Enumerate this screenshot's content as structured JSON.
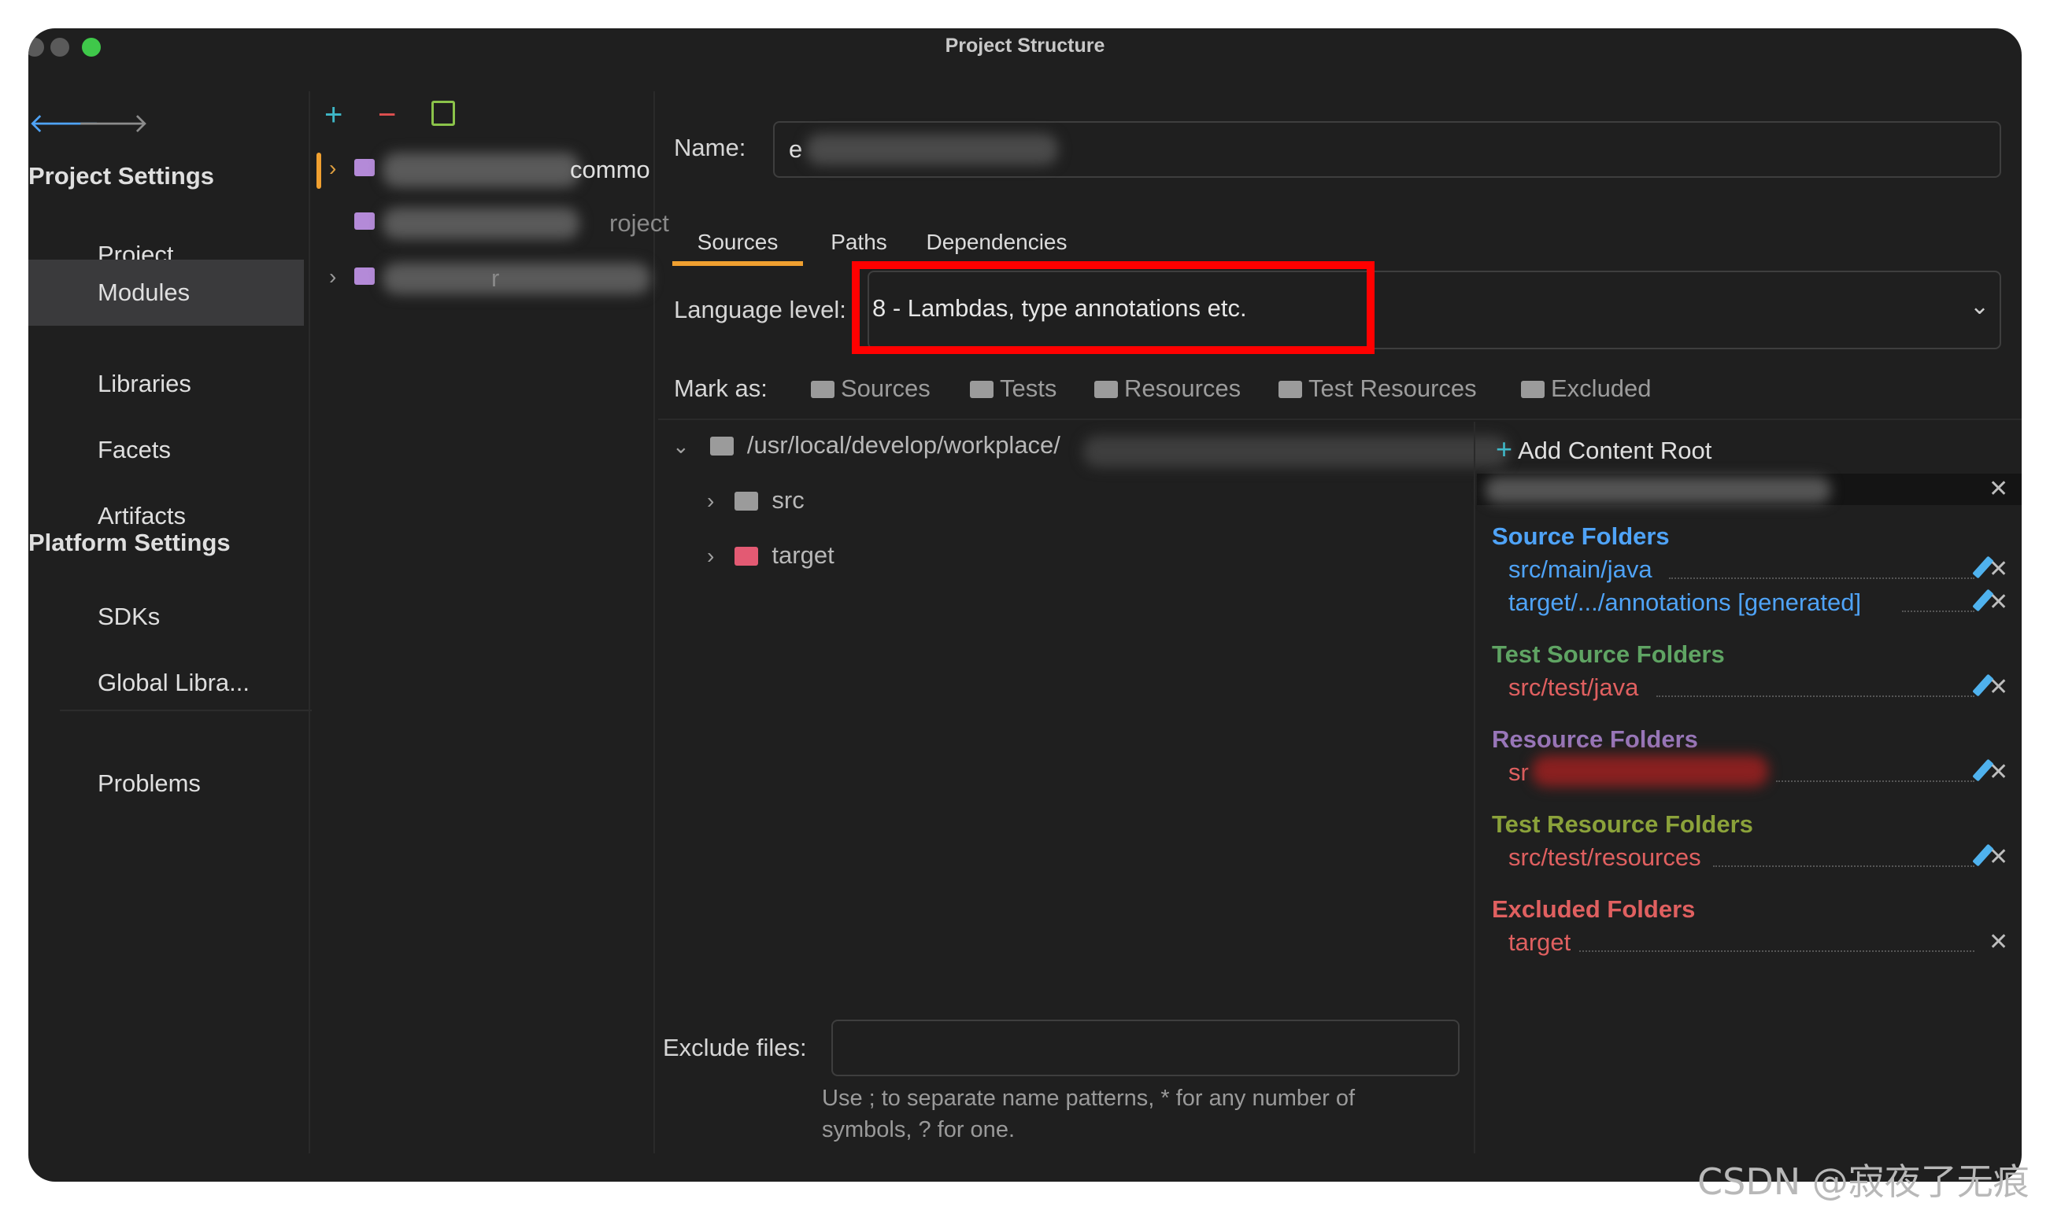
{
  "window": {
    "title": "Project Structure"
  },
  "colors": {
    "window_bg": "#1f1f1f",
    "selected_nav": "#3a3a3c",
    "tab_underline": "#f0a030",
    "highlight_box": "#ff0000",
    "source_folders": "#4fa3f7",
    "test_source_folders": "#5fa463",
    "resource_folders": "#9876b8",
    "test_resource_folders": "#8ba23a",
    "excluded_folders": "#e06060"
  },
  "nav": {
    "back_icon": "arrow-left-icon",
    "forward_icon": "arrow-right-icon",
    "project_settings_heading": "Project Settings",
    "project_settings_items": [
      "Project",
      "Modules",
      "Libraries",
      "Facets",
      "Artifacts"
    ],
    "active_item": "Modules",
    "platform_settings_heading": "Platform Settings",
    "platform_settings_items": [
      "SDKs",
      "Global Libra..."
    ],
    "problems": "Problems"
  },
  "modules_toolbar": {
    "add_icon": "plus-icon",
    "remove_icon": "minus-icon",
    "copy_icon": "copy-icon"
  },
  "modules_tree": {
    "visible_fragments": [
      "commo",
      "roject",
      "r"
    ]
  },
  "module": {
    "name_label": "Name:",
    "name_value": "e",
    "tabs": [
      "Sources",
      "Paths",
      "Dependencies"
    ],
    "active_tab": "Sources",
    "language_level_label": "Language level:",
    "language_level_value": "8 - Lambdas, type annotations etc.",
    "mark_as_label": "Mark as:",
    "mark_as_options": [
      "Sources",
      "Tests",
      "Resources",
      "Test Resources",
      "Excluded"
    ],
    "content_root_path": "/usr/local/develop/workplace/",
    "tree_children": [
      "src",
      "target"
    ],
    "add_content_root": "Add Content Root",
    "exclude_files_label": "Exclude files:",
    "exclude_files_value": "",
    "exclude_hint_line1": "Use ; to separate name patterns, * for any number of",
    "exclude_hint_line2": "symbols, ? for one."
  },
  "roots_panel": {
    "close_icon": "close-icon",
    "source_folders_heading": "Source Folders",
    "source_folders": [
      "src/main/java",
      "target/.../annotations [generated]"
    ],
    "test_source_folders_heading": "Test Source Folders",
    "test_source_folders": [
      "src/test/java"
    ],
    "resource_folders_heading": "Resource Folders",
    "resource_folders": [
      "sr"
    ],
    "test_resource_folders_heading": "Test Resource Folders",
    "test_resource_folders": [
      "src/test/resources"
    ],
    "excluded_folders_heading": "Excluded Folders",
    "excluded_folders": [
      "target"
    ]
  },
  "watermark": "CSDN @寂夜了无痕"
}
